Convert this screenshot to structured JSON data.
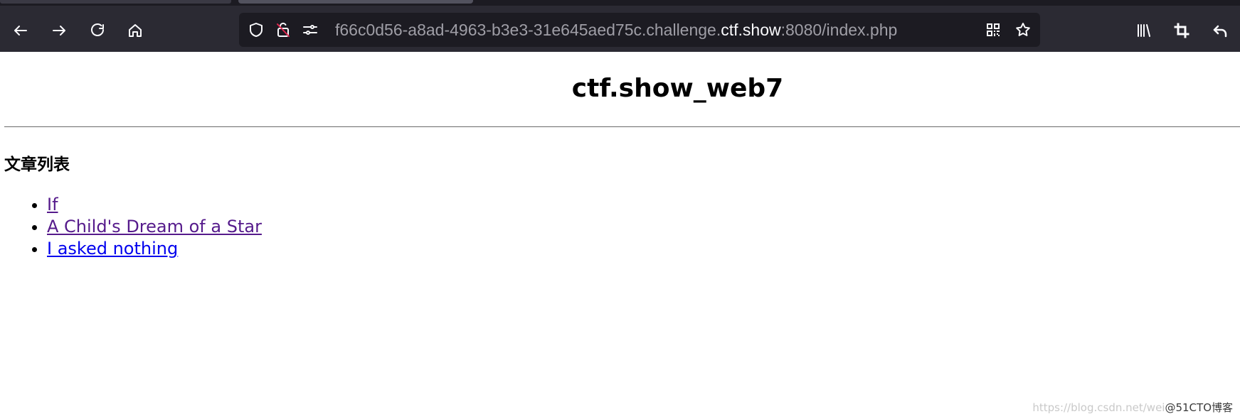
{
  "browser": {
    "url_prefix": "f66c0d56-a8ad-4963-b3e3-31e645aed75c.challenge.",
    "url_domain": "ctf.show",
    "url_suffix": ":8080/index.php",
    "icons": [
      "back-icon",
      "forward-icon",
      "reload-icon",
      "home-icon",
      "shield-icon",
      "insecure-lock-icon",
      "permissions-icon",
      "qr-code-icon",
      "bookmark-star-icon",
      "library-icon",
      "crop-icon",
      "undo-icon"
    ]
  },
  "page": {
    "title": "ctf.show_web7",
    "section_heading": "文章列表",
    "articles": [
      {
        "label": "If",
        "state": "visited"
      },
      {
        "label": "A Child's Dream of a Star",
        "state": "visited"
      },
      {
        "label": "I asked nothing",
        "state": "unvisited"
      }
    ]
  },
  "watermark": {
    "faint_text": "https://blog.csdn.net/wei",
    "text": "@51CTO博客"
  },
  "colors": {
    "chrome_bg": "#2b2a33",
    "urlbar_bg": "#1c1b22",
    "visited_link": "#551a8b",
    "unvisited_link": "#0000ee"
  }
}
